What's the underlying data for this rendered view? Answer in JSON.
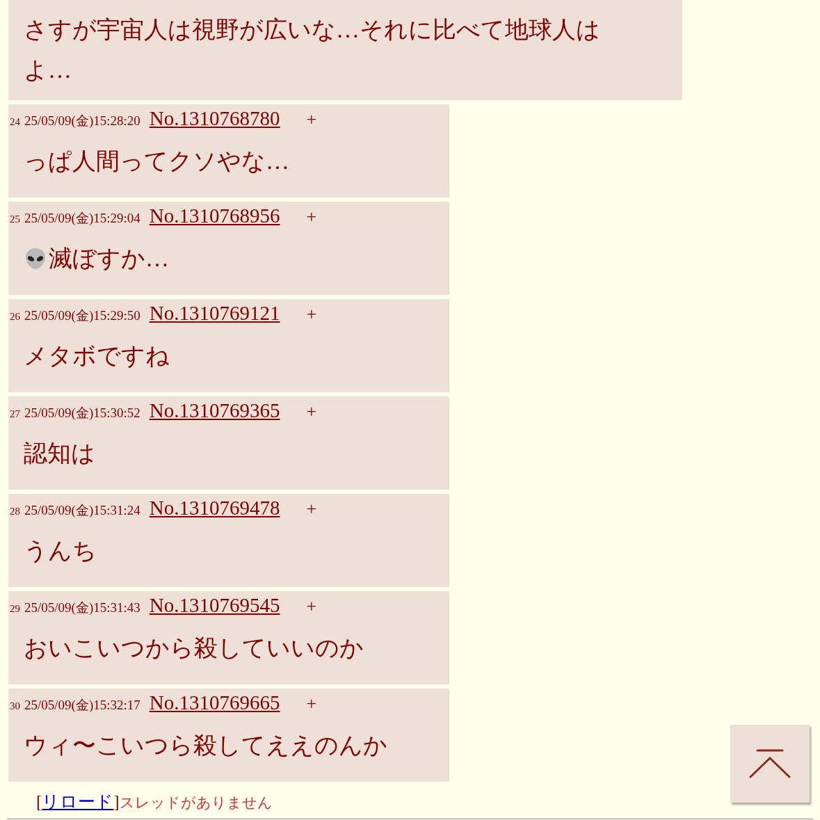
{
  "top_post": {
    "body": "さすが宇宙人は視野が広いな…それに比べて地球人はよ…"
  },
  "posts": [
    {
      "index": "24",
      "date": "25/05/09(金)15:28:20",
      "no": "No.1310768780",
      "plus": "+",
      "body": "っぱ人間ってクソやな…",
      "has_icon": false
    },
    {
      "index": "25",
      "date": "25/05/09(金)15:29:04",
      "no": "No.1310768956",
      "plus": "+",
      "body": "滅ぼすか…",
      "has_icon": true
    },
    {
      "index": "26",
      "date": "25/05/09(金)15:29:50",
      "no": "No.1310769121",
      "plus": "+",
      "body": "メタボですね",
      "has_icon": false
    },
    {
      "index": "27",
      "date": "25/05/09(金)15:30:52",
      "no": "No.1310769365",
      "plus": "+",
      "body": "認知は",
      "has_icon": false
    },
    {
      "index": "28",
      "date": "25/05/09(金)15:31:24",
      "no": "No.1310769478",
      "plus": "+",
      "body": "うんち",
      "has_icon": false
    },
    {
      "index": "29",
      "date": "25/05/09(金)15:31:43",
      "no": "No.1310769545",
      "plus": "+",
      "body": "おいこいつから殺していいのか",
      "has_icon": false
    },
    {
      "index": "30",
      "date": "25/05/09(金)15:32:17",
      "no": "No.1310769665",
      "plus": "+",
      "body": "ウィ〜こいつら殺してええのんか",
      "has_icon": false
    }
  ],
  "footer": {
    "open_bracket": "[",
    "reload": "リロード",
    "close_bracket": "]",
    "message": "スレッドがありません"
  }
}
